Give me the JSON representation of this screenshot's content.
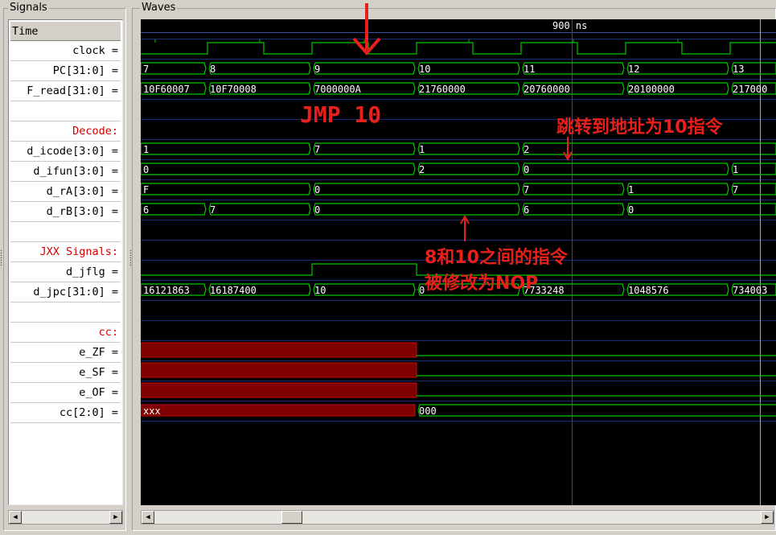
{
  "panels": {
    "signals_title": "Signals",
    "waves_title": "Waves"
  },
  "signals": [
    {
      "label": "Time",
      "kind": "time"
    },
    {
      "label": "clock =",
      "kind": "sig"
    },
    {
      "label": "PC[31:0] =",
      "kind": "sig"
    },
    {
      "label": "F_read[31:0] =",
      "kind": "sig"
    },
    {
      "label": "",
      "kind": "blank"
    },
    {
      "label": "Decode:",
      "kind": "section"
    },
    {
      "label": "d_icode[3:0] =",
      "kind": "sig"
    },
    {
      "label": "d_ifun[3:0] =",
      "kind": "sig"
    },
    {
      "label": "d_rA[3:0] =",
      "kind": "sig"
    },
    {
      "label": "d_rB[3:0] =",
      "kind": "sig"
    },
    {
      "label": "",
      "kind": "blank"
    },
    {
      "label": "JXX Signals:",
      "kind": "section"
    },
    {
      "label": "d_jflg =",
      "kind": "sig"
    },
    {
      "label": "d_jpc[31:0] =",
      "kind": "sig"
    },
    {
      "label": "",
      "kind": "blank"
    },
    {
      "label": "cc:",
      "kind": "section"
    },
    {
      "label": "e_ZF =",
      "kind": "sig"
    },
    {
      "label": "e_SF =",
      "kind": "sig"
    },
    {
      "label": "e_OF =",
      "kind": "sig"
    },
    {
      "label": "cc[2:0] =",
      "kind": "sig"
    }
  ],
  "timeline": {
    "marker_label": "900 ns"
  },
  "buses": {
    "PC": [
      "7",
      "8",
      "9",
      "10",
      "11",
      "12",
      "13"
    ],
    "F_read": [
      "10F60007",
      "10F70008",
      "7000000A",
      "21760000",
      "20760000",
      "20100000",
      "217000"
    ],
    "d_icode": [
      "1",
      "7",
      "1",
      "2"
    ],
    "d_ifun": [
      "0",
      "2",
      "0",
      "1"
    ],
    "d_rA": [
      "F",
      "0",
      "7",
      "1",
      "7"
    ],
    "d_rB": [
      "6",
      "7",
      "0",
      "6",
      "0"
    ],
    "d_jpc": [
      "16121863",
      "16187400",
      "10",
      "0",
      "7733248",
      "1048576",
      "734003"
    ],
    "cc": [
      "xxx",
      "000"
    ]
  },
  "annotations": {
    "jmp": "JMP 10",
    "jump_target": "跳转到地址为10指令",
    "nop_line1": "8和10之间的指令",
    "nop_line2": "被修改为NOP"
  },
  "colors": {
    "wave": "#00c800",
    "undefined_fill": "#800000",
    "annotation": "#e8201c",
    "cursor": "#ff8080",
    "grid": "#1c2a78"
  }
}
